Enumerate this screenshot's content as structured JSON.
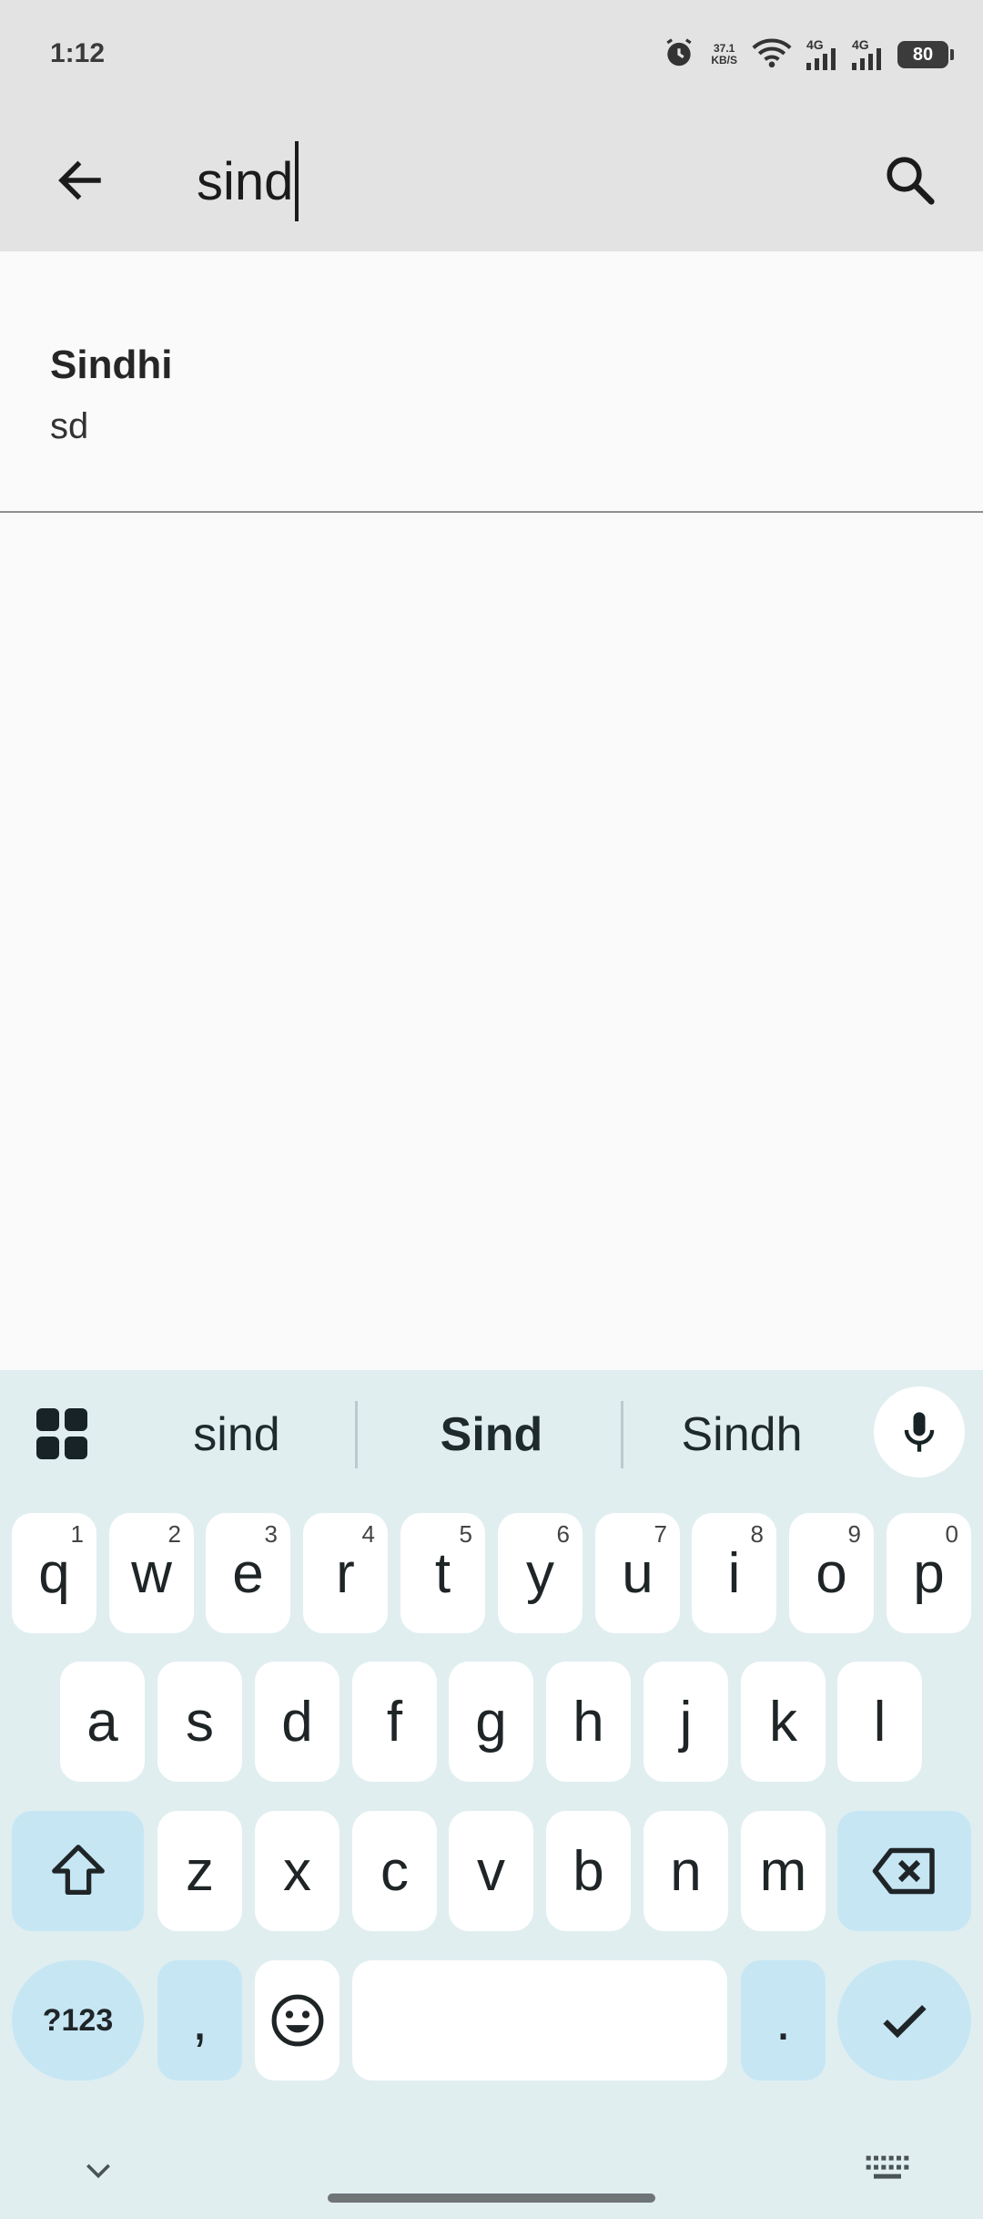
{
  "status_bar": {
    "time": "1:12",
    "net_speed_value": "37.1",
    "net_speed_unit": "KB/S",
    "signal1_label": "4G",
    "signal2_label": "4G",
    "battery": "80"
  },
  "app_bar": {
    "query": "sind"
  },
  "results": [
    {
      "name": "Sindhi",
      "code": "sd"
    }
  ],
  "keyboard": {
    "suggestions": [
      "sind",
      "Sind",
      "Sindh"
    ],
    "row1": [
      {
        "key": "q",
        "hint": "1"
      },
      {
        "key": "w",
        "hint": "2"
      },
      {
        "key": "e",
        "hint": "3"
      },
      {
        "key": "r",
        "hint": "4"
      },
      {
        "key": "t",
        "hint": "5"
      },
      {
        "key": "y",
        "hint": "6"
      },
      {
        "key": "u",
        "hint": "7"
      },
      {
        "key": "i",
        "hint": "8"
      },
      {
        "key": "o",
        "hint": "9"
      },
      {
        "key": "p",
        "hint": "0"
      }
    ],
    "row2": [
      "a",
      "s",
      "d",
      "f",
      "g",
      "h",
      "j",
      "k",
      "l"
    ],
    "row3": [
      "z",
      "x",
      "c",
      "v",
      "b",
      "n",
      "m"
    ],
    "symbols_label": "?123",
    "comma_label": ",",
    "period_label": "."
  },
  "colors": {
    "app_bar_bg": "#e3e3e3",
    "keyboard_bg": "#e0eef0",
    "modifier_key_bg": "#c6e6f4"
  }
}
